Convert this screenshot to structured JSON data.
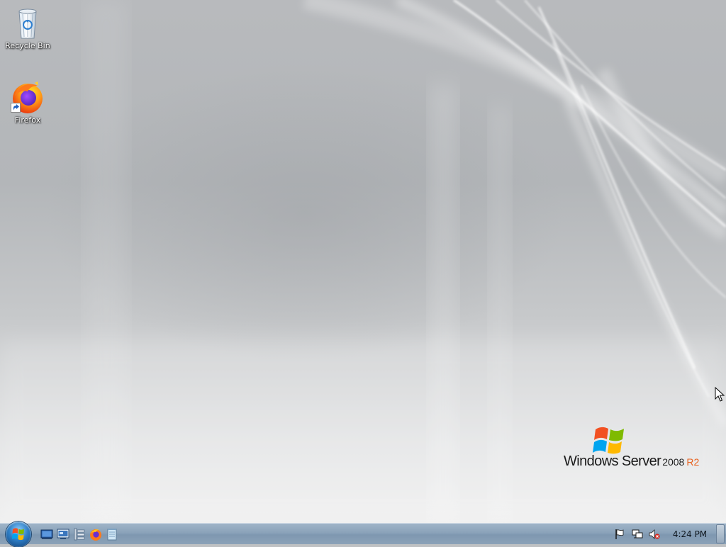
{
  "desktop": {
    "icons": [
      {
        "label": "Recycle Bin",
        "icon": "recycle-bin-icon"
      },
      {
        "label": "Firefox",
        "icon": "firefox-icon"
      }
    ],
    "branding": {
      "wordmark": "Windows Server",
      "version": "2008",
      "edition": "R2",
      "edition_color": "#e8601c"
    }
  },
  "taskbar": {
    "start_button": "start-orb-icon",
    "quick_launch": [
      "show-desktop-shortcut-icon",
      "server-manager-icon",
      "windows-explorer-icon",
      "firefox-icon",
      "notepad-icon"
    ],
    "tray": [
      "action-center-flag-icon",
      "network-icon",
      "volume-muted-icon"
    ],
    "clock": "4:24 PM"
  },
  "colors": {
    "taskbar": "#8aa2b9",
    "wallpaper": "#bfc1c3",
    "accent_r2": "#e8601c"
  }
}
